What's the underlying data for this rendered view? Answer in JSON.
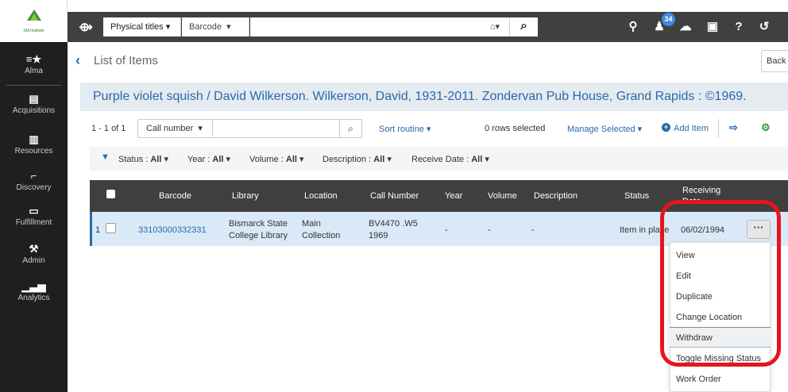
{
  "brand": {
    "logo_text": "SM Institute"
  },
  "sidebar": {
    "items": [
      {
        "label": "Alma",
        "icon": "alma-star-icon"
      },
      {
        "label": "Acquisitions",
        "icon": "acquisitions-icon"
      },
      {
        "label": "Resources",
        "icon": "resources-books-icon"
      },
      {
        "label": "Discovery",
        "icon": "discovery-telescope-icon"
      },
      {
        "label": "Fulfillment",
        "icon": "fulfillment-box-icon"
      },
      {
        "label": "Admin",
        "icon": "admin-wrench-icon"
      },
      {
        "label": "Analytics",
        "icon": "analytics-chart-icon"
      }
    ]
  },
  "topbar": {
    "search_scope": "Physical titles",
    "search_field": "Barcode",
    "search_value": "",
    "notification_count": "34",
    "icons": [
      "location-pin-icon",
      "user-icon",
      "notifications-icon",
      "tasks-clipboard-icon",
      "help-icon",
      "history-icon"
    ]
  },
  "page": {
    "title": "List of Items",
    "back_button": "Back",
    "record_title": "Purple violet squish / David Wilkerson. Wilkerson, David, 1931-2011. Zondervan Pub House, Grand Rapids : ©1969."
  },
  "toolbar": {
    "count": "1 - 1 of 1",
    "filter_field": "Call number",
    "sort_label": "Sort routine",
    "rows_selected": "0 rows selected",
    "manage_selected": "Manage Selected",
    "add_item": "Add Item"
  },
  "filters": [
    {
      "label": "Status :",
      "value": "All"
    },
    {
      "label": "Year :",
      "value": "All"
    },
    {
      "label": "Volume :",
      "value": "All"
    },
    {
      "label": "Description :",
      "value": "All"
    },
    {
      "label": "Receive Date :",
      "value": "All"
    }
  ],
  "table": {
    "columns": [
      "Barcode",
      "Library",
      "Location",
      "Call Number",
      "Year",
      "Volume",
      "Description",
      "Status",
      "Receiving Date"
    ],
    "rows": [
      {
        "num": "1",
        "barcode": "33103000332331",
        "library_line1": "Bismarck State",
        "library_line2": "College Library",
        "location_line1": "Main",
        "location_line2": "Collection",
        "call_line1": "BV4470 .W5",
        "call_line2": "1969",
        "year": "-",
        "volume": "-",
        "description": "-",
        "status": "Item in place",
        "receiving_date": "06/02/1994"
      }
    ]
  },
  "row_menu": {
    "button": "···",
    "items": [
      "View",
      "Edit",
      "Duplicate",
      "Change Location",
      "Withdraw",
      "Toggle Missing Status",
      "Work Order"
    ],
    "highlighted": "Withdraw"
  },
  "colors": {
    "accent": "#2a6aa8",
    "annotation": "#e8141b",
    "header_dark": "#404040"
  }
}
